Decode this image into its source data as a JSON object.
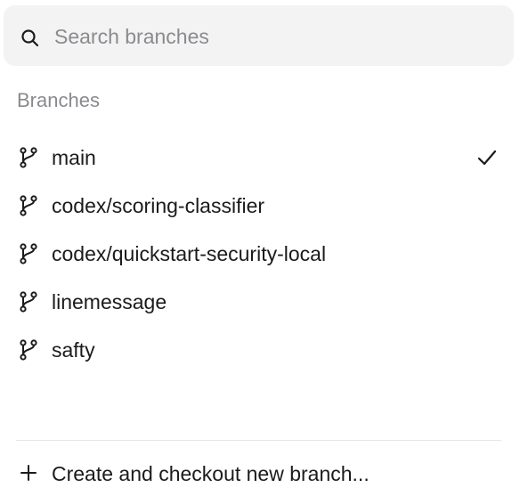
{
  "search": {
    "placeholder": "Search branches",
    "value": "",
    "icon": "search-icon"
  },
  "section": {
    "title": "Branches"
  },
  "branches": [
    {
      "name": "main",
      "selected": true,
      "icon": "git-branch-icon"
    },
    {
      "name": "codex/scoring-classifier",
      "selected": false,
      "icon": "git-branch-icon"
    },
    {
      "name": "codex/quickstart-security-local",
      "selected": false,
      "icon": "git-branch-icon"
    },
    {
      "name": "linemessage",
      "selected": false,
      "icon": "git-branch-icon"
    },
    {
      "name": "safty",
      "selected": false,
      "icon": "git-branch-icon"
    }
  ],
  "footer": {
    "create_label": "Create and checkout new branch...",
    "icon": "plus-icon"
  },
  "colors": {
    "text": "#1b1b1d",
    "muted": "#8a8a8e",
    "search_bg": "#f3f3f3",
    "divider": "#e5e5e5"
  }
}
